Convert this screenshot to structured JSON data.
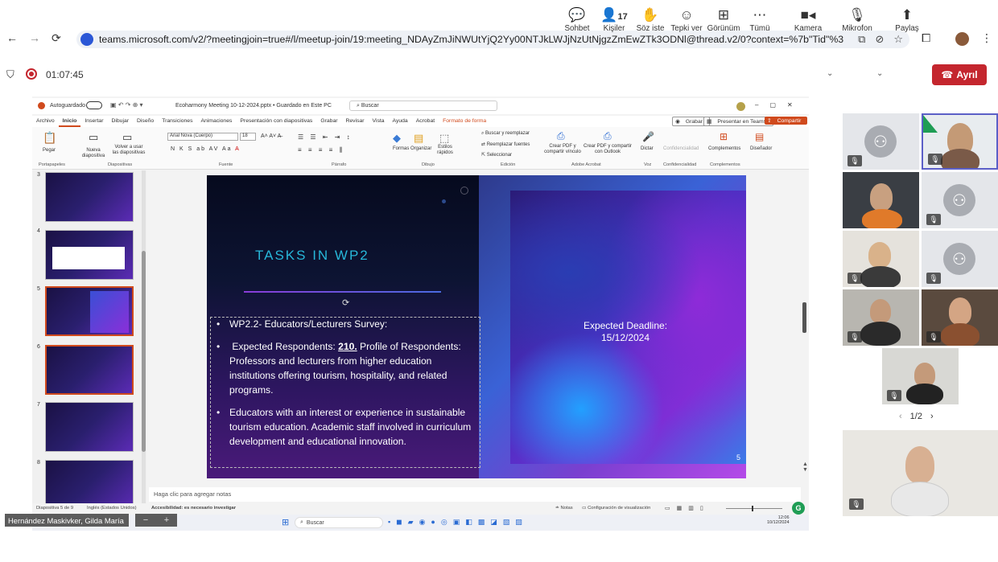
{
  "browser": {
    "url": "teams.microsoft.com/v2/?meetingjoin=true#/l/meetup-join/19:meeting_NDAyZmJiNWUtYjQ2Yy00NTJkLWJjNzUtNjgzZmEwZTk3ODNl@thread.v2/0?context=%7b\"Tid\"%3a\"facbc786-..."
  },
  "meeting": {
    "timer": "01:07:45",
    "participant_count": "17",
    "leave_label": "Ayrıl",
    "toolbar": [
      {
        "label": "Sohbet",
        "icon": "chat-icon"
      },
      {
        "label": "Kişiler",
        "icon": "people-icon"
      },
      {
        "label": "Söz iste",
        "icon": "raise-hand-icon"
      },
      {
        "label": "Tepki ver",
        "icon": "smile-icon"
      },
      {
        "label": "Görünüm",
        "icon": "view-icon"
      },
      {
        "label": "Tümü",
        "icon": "more-icon"
      },
      {
        "label": "Kamera",
        "icon": "camera-icon"
      },
      {
        "label": "Mikrofon",
        "icon": "mic-icon"
      },
      {
        "label": "Paylaş",
        "icon": "share-icon"
      }
    ]
  },
  "ppt": {
    "autosave": "Autoguardado",
    "file_title": "Ecoharmony Meeting 10-12-2024.pptx • Guardado en Este PC",
    "search_placeholder": "Buscar",
    "tabs": [
      "Archivo",
      "Inicio",
      "Insertar",
      "Dibujar",
      "Diseño",
      "Transiciones",
      "Animaciones",
      "Presentación con diapositivas",
      "Grabar",
      "Revisar",
      "Vista",
      "Ayuda",
      "Acrobat",
      "Formato de forma"
    ],
    "record_label": "Grabar",
    "present_teams_label": "Presentar en Teams",
    "share_label": "Compartir",
    "font_name": "Arial Nova (Cuerpo)",
    "font_size": "18",
    "ribbon_buttons": {
      "pegar": "Pegar",
      "nueva": "Nueva diapositiva",
      "volver": "Volver a usar las diapositivas",
      "formas": "Formas",
      "organizar": "Organizar",
      "estilos": "Estilos rápidos",
      "buscar": "Buscar y reemplazar",
      "reemplazar": "Reemplazar fuentes",
      "seleccionar": "Seleccionar",
      "pdf_share": "Crear PDF y compartir vínculo",
      "pdf_outlook": "Crear PDF y compartir con Outlook",
      "dictar": "Dictar",
      "confidencialidad": "Confidencialidad",
      "complementos": "Complementos",
      "disenador": "Diseñador"
    },
    "ribbon_groups": [
      "Portapapeles",
      "Diapositivas",
      "Fuente",
      "Párrafo",
      "Dibujo",
      "Edición",
      "Adobe Acrobat",
      "Voz",
      "Confidencialidad",
      "Complementos"
    ],
    "thumbnails": [
      "3",
      "4",
      "5",
      "6",
      "7",
      "8"
    ],
    "selected_slide": "5",
    "slide": {
      "title": "TASKS IN WP2",
      "bullet1": "WP2.2- Educators/Lecturers Survey:",
      "bullet2_prefix": " Expected Respondents: ",
      "bullet2_bold": "210.",
      "bullet2_rest": " Profile of Respondents: Professors and lecturers from higher education institutions offering tourism, hospitality, and related programs.",
      "bullet3": "Educators with an interest or experience in sustainable tourism education. Academic staff involved in curriculum development and educational innovation.",
      "deadline_label": "Expected Deadline:",
      "deadline_date": "15/12/2024",
      "number": "5"
    },
    "notes_placeholder": "Haga clic para agregar notas",
    "status": {
      "slide_info": "Diapositiva 5 de 9",
      "language": "Inglés (Estados Unidos)",
      "accessibility": "Accesibilidad: es necesario investigar",
      "notes": "Notas",
      "view_settings": "Configuración de visualización"
    },
    "taskbar": {
      "search": "Buscar",
      "date": "10/12/2024",
      "time": "12:06"
    }
  },
  "presenter": {
    "name": "Hernández Maskivker, Gilda María"
  },
  "pager": "1/2",
  "colors": {
    "leave": "#c4262e",
    "slide_title": "#27b7d9",
    "selected_thumb": "#d04a1d"
  }
}
